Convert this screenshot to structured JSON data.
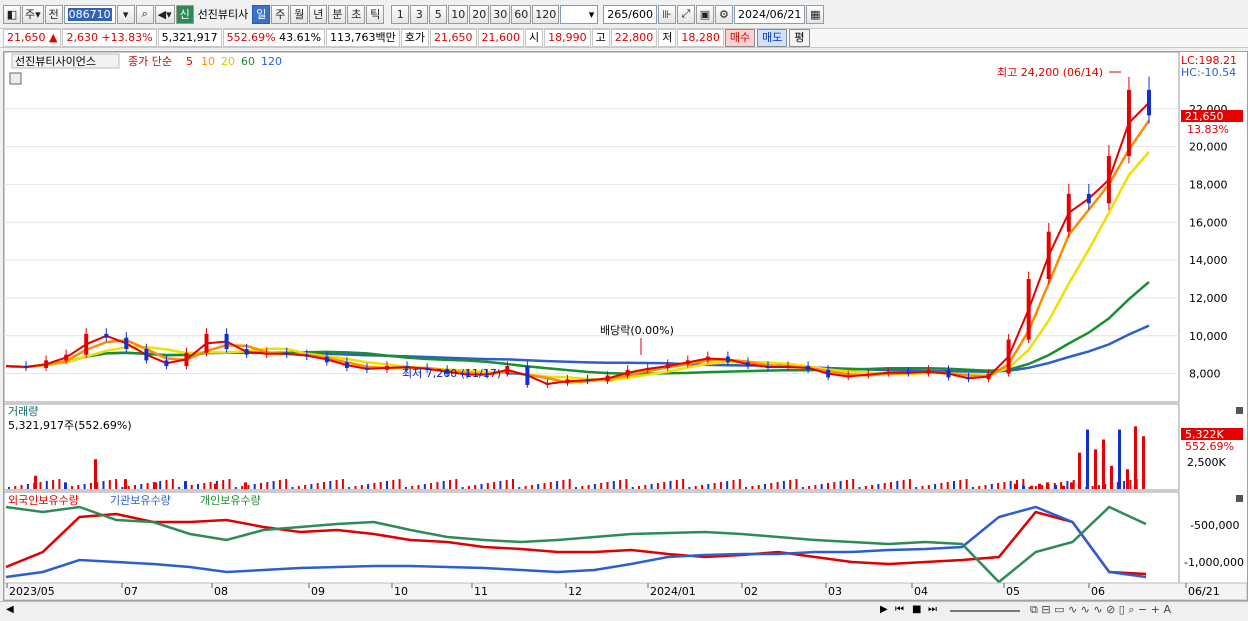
{
  "toolbar": {
    "market": "주",
    "mode": "전",
    "code": "086710",
    "badge": "신",
    "name": "선진뷰티사",
    "periods": [
      "일",
      "주",
      "월",
      "년",
      "분",
      "초",
      "틱"
    ],
    "nums": [
      "1",
      "3",
      "5",
      "10",
      "20",
      "30",
      "60",
      "120"
    ],
    "count": "265",
    "total": "/600",
    "date": "2024/06/21"
  },
  "quote": {
    "price": "21,650",
    "arrow": "▲",
    "change": "2,630",
    "rate": "+13.83%",
    "volume": "5,321,917",
    "vol_rate": "552.69%",
    "turnover": "43.61%",
    "amount": "113,763백만",
    "ask_label": "호가",
    "ask": "21,650",
    "bid": "21,600",
    "open_label": "시",
    "open": "18,990",
    "high_label": "고",
    "high": "22,800",
    "low_label": "저",
    "low": "18,280",
    "buy": "매수",
    "sell": "매도",
    "eval": "평"
  },
  "chart_data": {
    "type": "line",
    "title": "선진뷰티사이언스",
    "ma_label": "종가 단순",
    "ma_periods": [
      "5",
      "10",
      "20",
      "60",
      "120"
    ],
    "colors": {
      "p5": "#e60000",
      "p10": "#ff8c00",
      "p20": "#f0e000",
      "p60": "#1a8f2e",
      "p120": "#2a5fd0",
      "candle_up": "#e60000",
      "candle_down": "#1030d0"
    },
    "x": [
      "2023/05",
      "07",
      "08",
      "09",
      "10",
      "11",
      "12",
      "2024/01",
      "02",
      "03",
      "04",
      "05",
      "06",
      "06/21"
    ],
    "ylim": [
      6500,
      25000
    ],
    "y_ticks": [
      "22,000",
      "20,000",
      "18,000",
      "16,000",
      "14,000",
      "12,000",
      "10,000",
      "8,000"
    ],
    "close_series": [
      8400,
      8300,
      8700,
      9000,
      10100,
      9900,
      9300,
      8700,
      8400,
      9100,
      10100,
      9300,
      9000,
      9100,
      9000,
      8900,
      8600,
      8300,
      8200,
      8400,
      8300,
      8200,
      8000,
      7900,
      8000,
      8400,
      7400,
      7500,
      7700,
      7600,
      7900,
      8200,
      8300,
      8500,
      8700,
      8900,
      8600,
      8400,
      8300,
      8400,
      8200,
      7800,
      7900,
      8000,
      8100,
      8000,
      8200,
      7800,
      7700,
      8000,
      9800,
      13000,
      15500,
      17500,
      17000,
      19500,
      23000,
      21650
    ],
    "events": {
      "high": "최고 24,200 (06/14)",
      "low": "최저 7,260 (11/17)",
      "dividend": "배당락(0.00%)"
    },
    "lc": "LC:198.21",
    "hc": "HC:-10.54",
    "last_price": "21,650",
    "last_rate": "13.83%",
    "volume_panel": {
      "title": "거래량",
      "value": "5,321,917주(552.69%)",
      "tick": "2,500K",
      "last": "5,322K",
      "last_rate": "552.69%",
      "spikes": [
        0.2,
        0.1,
        0.45,
        0.15,
        0.1,
        0.12,
        0.08,
        0.1,
        0.08,
        0.05,
        0.05,
        0.08,
        0.1,
        0.06,
        0.05,
        0.1,
        0.55,
        0.9,
        0.6,
        0.75,
        0.35,
        0.9,
        0.3,
        0.95,
        0.8
      ]
    },
    "holdings_panel": {
      "series": [
        "외국인보유수량",
        "기관보유수량",
        "개인보유수량"
      ],
      "ticks": [
        "-500,000",
        "-1,000,000"
      ]
    }
  },
  "status": {
    "nav_icons": [
      "prev-icon",
      "first-icon",
      "stop-icon",
      "last-icon"
    ]
  }
}
